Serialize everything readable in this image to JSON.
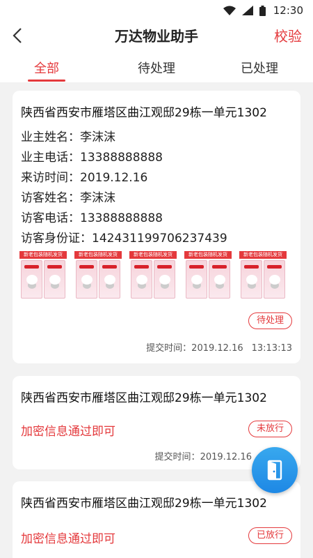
{
  "status_bar": {
    "time": "12:30"
  },
  "header": {
    "title": "万达物业助手",
    "action_label": "校验"
  },
  "tabs": [
    {
      "label": "全部"
    },
    {
      "label": "待处理"
    },
    {
      "label": "已处理"
    }
  ],
  "cards": [
    {
      "address": "陕西省西安市雁塔区曲江观邸29栋一单元1302",
      "fields": [
        {
          "label": "业主姓名：",
          "value": "李沫沫"
        },
        {
          "label": "业主电话：",
          "value": "13388888888"
        },
        {
          "label": "来访时间：",
          "value": "2019.12.16"
        },
        {
          "label": "访客姓名：",
          "value": "李沫沫"
        },
        {
          "label": "访客电话：",
          "value": "13388888888"
        },
        {
          "label": "访客身份证：",
          "value": "142431199706237439"
        }
      ],
      "image_banner": "新老包装随机发货",
      "image_count": 5,
      "status": "待处理",
      "submit_label": "提交时间：",
      "submit_date": "2019.12.16",
      "submit_clock": "13:13:13"
    },
    {
      "address": "陕西省西安市雁塔区曲江观邸29栋一单元1302",
      "note": "加密信息通过即可",
      "status": "未放行",
      "submit_label": "提交时间：",
      "submit_date": "2019.12.16"
    },
    {
      "address": "陕西省西安市雁塔区曲江观邸29栋一单元1302",
      "note": "加密信息通过即可",
      "status": "已放行"
    }
  ],
  "colors": {
    "accent": "#e4393c",
    "fab": "#1e88e5",
    "background": "#f2f2f2"
  },
  "icons": {
    "fab": "door-icon",
    "back": "back-arrow-icon"
  }
}
